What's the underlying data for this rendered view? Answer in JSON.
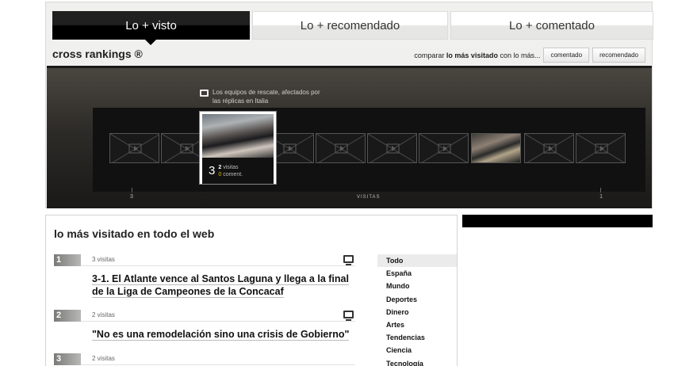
{
  "tabs": [
    {
      "label": "Lo + visto"
    },
    {
      "label": "Lo + recomendado"
    },
    {
      "label": "Lo + comentado"
    }
  ],
  "brand": "cross rankings ®",
  "compare": {
    "prefix": "comparar ",
    "bold": "lo más visitado",
    "suffix": " con lo más...",
    "buttons": [
      "comentado",
      "recomendado"
    ]
  },
  "tooltip": "Los equipos de rescate, afectados por las réplicas en Italia",
  "feature": {
    "rank": "3",
    "visits": "2",
    "visits_label": "visitas",
    "comments": "0",
    "comments_label": "coment."
  },
  "scale": {
    "left": "3",
    "center": "VISITAS",
    "right": "1"
  },
  "panel_title": "lo más visitado en todo el web",
  "entries": [
    {
      "num": "1",
      "visits": "3 visitas",
      "headline": "3-1. El Atlante vence al Santos Laguna y llega a la final de la Liga de Campeones de la Concacaf"
    },
    {
      "num": "2",
      "visits": "2 visitas",
      "headline": "\"No es una remodelación sino una crisis de Gobierno\""
    },
    {
      "num": "3",
      "visits": "2 visitas",
      "headline": ""
    }
  ],
  "categories": [
    "Todo",
    "España",
    "Mundo",
    "Deportes",
    "Dinero",
    "Artes",
    "Tendencias",
    "Ciencia",
    "Tecnología"
  ],
  "icons": {
    "video": "tv-icon",
    "thumb": "video-thumb-icon"
  },
  "colors": {
    "accent": "#e8b800",
    "tab_active": "#000000",
    "stage": "#2d2b27"
  }
}
